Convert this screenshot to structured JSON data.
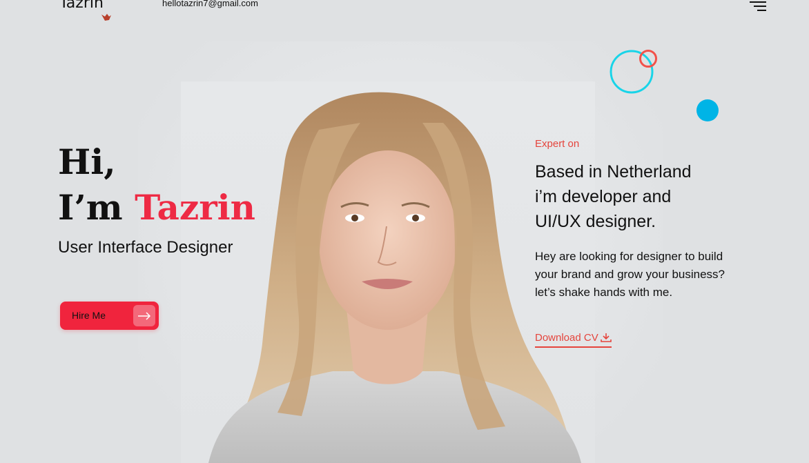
{
  "header": {
    "logo_text": "Tazrin",
    "email": "hellotazrin7@gmail.com",
    "menu_icon": "hamburger-menu-icon"
  },
  "hero": {
    "greeting": "Hi,",
    "intro_prefix": "I’m ",
    "name": "Tazrin",
    "role": "User Interface Designer",
    "hire_button_label": "Hire Me",
    "hire_button_icon": "arrow-right-icon"
  },
  "about": {
    "expert_label": "Expert on",
    "headline_lines": [
      "Based in Netherland",
      "i’m developer and",
      "UI/UX designer."
    ],
    "description_lines": [
      "Hey are looking for designer to build",
      "your brand and grow your business?",
      "let’s shake hands with me."
    ],
    "download_label": "Download CV",
    "download_icon": "download-icon"
  },
  "colors": {
    "accent_red": "#ee2a44",
    "button_red": "#f0243d",
    "link_red": "#e5443c",
    "cyan": "#19d4e8",
    "blue_dot": "#00b4e6",
    "background": "#dfe1e3"
  }
}
